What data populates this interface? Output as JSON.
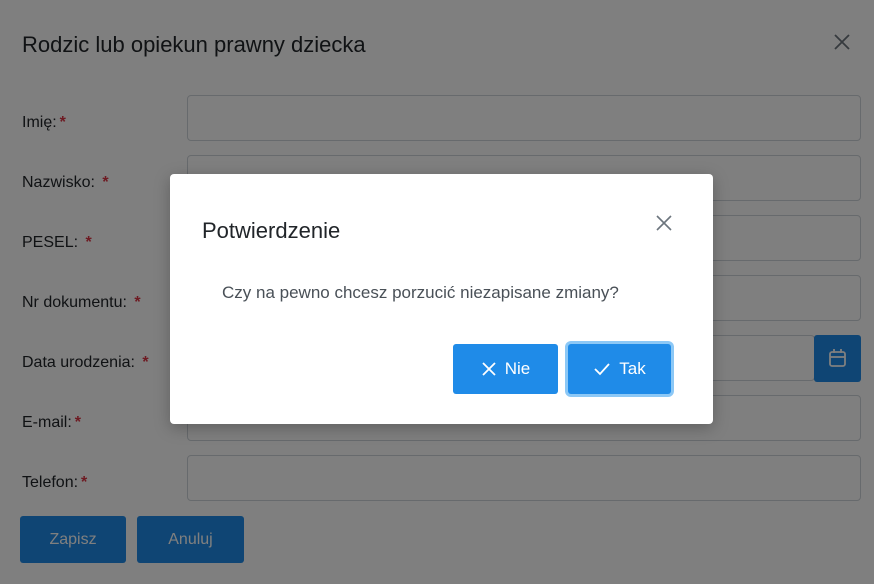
{
  "form": {
    "title": "Rodzic lub opiekun prawny dziecka",
    "required_mark": "*",
    "fields": [
      {
        "label": "Imię:"
      },
      {
        "label": "Nazwisko: "
      },
      {
        "label": "PESEL: "
      },
      {
        "label": "Nr dokumentu: "
      },
      {
        "label": "Data urodzenia: "
      },
      {
        "label": "E-mail:"
      },
      {
        "label": "Telefon:"
      }
    ],
    "save_label": "Zapisz",
    "cancel_label": "Anuluj"
  },
  "dialog": {
    "title": "Potwierdzenie",
    "message": "Czy na pewno chcesz porzucić niezapisane zmiany?",
    "no_label": "Nie",
    "yes_label": "Tak"
  },
  "colors": {
    "primary": "#1f8be8",
    "required": "#dc3545"
  },
  "icons": {
    "form_close": "close-icon",
    "dialog_close": "close-icon",
    "calendar": "calendar-icon",
    "no": "x-icon",
    "yes": "check-icon"
  }
}
